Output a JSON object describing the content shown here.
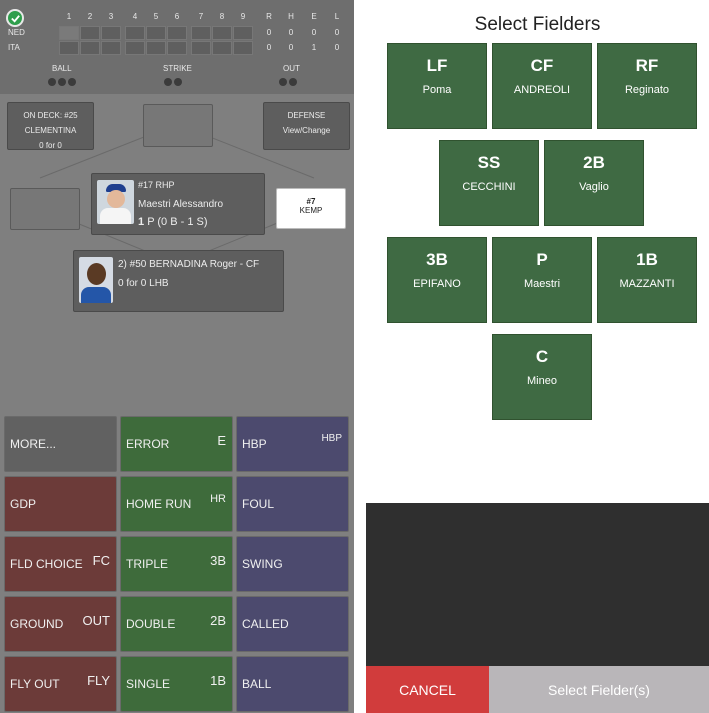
{
  "scoreboard": {
    "innings": [
      "1",
      "2",
      "3",
      "4",
      "5",
      "6",
      "7",
      "8",
      "9"
    ],
    "totals_headers": [
      "R",
      "H",
      "E",
      "L"
    ],
    "teams": [
      {
        "name": "NED",
        "totals": [
          "0",
          "0",
          "0",
          "0"
        ]
      },
      {
        "name": "ITA",
        "totals": [
          "0",
          "0",
          "1",
          "0"
        ]
      }
    ],
    "ball_label": "BALL",
    "strike_label": "STRIKE",
    "out_label": "OUT"
  },
  "on_deck": {
    "line1": "ON DECK: #25",
    "line2": "CLEMENTINA",
    "line3": "0 for 0"
  },
  "defense": {
    "line1": "DEFENSE",
    "line2": "View/Change"
  },
  "pitcher": {
    "number_role": "#17 RHP",
    "name": "Maestri Alessandro",
    "count_bold": "1",
    "count": "P (0 B - 1 S)"
  },
  "runner": {
    "number": "#7",
    "name": "KEMP"
  },
  "batter": {
    "line1": "2) #50 BERNADINA Roger - CF",
    "line2": "0 for 0 LHB"
  },
  "actions": [
    {
      "label": "MORE...",
      "sym": ""
    },
    {
      "label": "ERROR",
      "sym": "E"
    },
    {
      "label": "HBP",
      "sym": "HBP"
    },
    {
      "label": "GDP",
      "sym": ""
    },
    {
      "label": "HOME RUN",
      "sym": "HR"
    },
    {
      "label": "FOUL",
      "sym": ""
    },
    {
      "label": "FLD CHOICE",
      "sym": "FC"
    },
    {
      "label": "TRIPLE",
      "sym": "3B"
    },
    {
      "label": "SWING",
      "sym": ""
    },
    {
      "label": "GROUND",
      "sym": "OUT"
    },
    {
      "label": "DOUBLE",
      "sym": "2B"
    },
    {
      "label": "CALLED",
      "sym": ""
    },
    {
      "label": "FLY OUT",
      "sym": "FLY"
    },
    {
      "label": "SINGLE",
      "sym": "1B"
    },
    {
      "label": "BALL",
      "sym": ""
    }
  ],
  "fielder_panel": {
    "title": "Select Fielders",
    "fielders": [
      {
        "pos": "LF",
        "name": "Poma"
      },
      {
        "pos": "CF",
        "name": "ANDREOLI"
      },
      {
        "pos": "RF",
        "name": "Reginato"
      },
      {
        "pos": "SS",
        "name": "CECCHINI"
      },
      {
        "pos": "2B",
        "name": "Vaglio"
      },
      {
        "pos": "3B",
        "name": "EPIFANO"
      },
      {
        "pos": "P",
        "name": "Maestri"
      },
      {
        "pos": "1B",
        "name": "MAZZANTI"
      },
      {
        "pos": "C",
        "name": "Mineo"
      }
    ],
    "cancel_label": "CANCEL",
    "select_label": "Select Fielder(s)"
  },
  "colors": {
    "accent_red": "#d13c3c",
    "fielder_green": "#3f6a43"
  }
}
